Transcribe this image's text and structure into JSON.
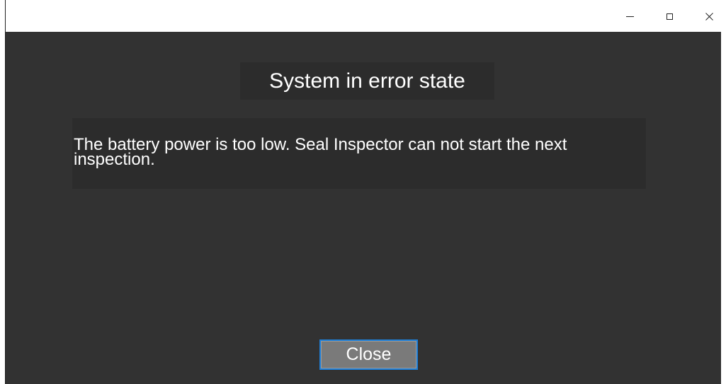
{
  "window": {
    "controls": {
      "minimize_icon": "minimize-icon",
      "maximize_icon": "maximize-icon",
      "close_icon": "close-icon"
    }
  },
  "dialog": {
    "title": "System in error state",
    "message": "The battery power is too low. Seal Inspector can not start the next inspection.",
    "close_label": "Close"
  },
  "colors": {
    "background": "#323232",
    "panel": "#2c2c2c",
    "text": "#ffffff",
    "button": "#7a7a7a",
    "button_focus_border": "#1e7fd8"
  }
}
